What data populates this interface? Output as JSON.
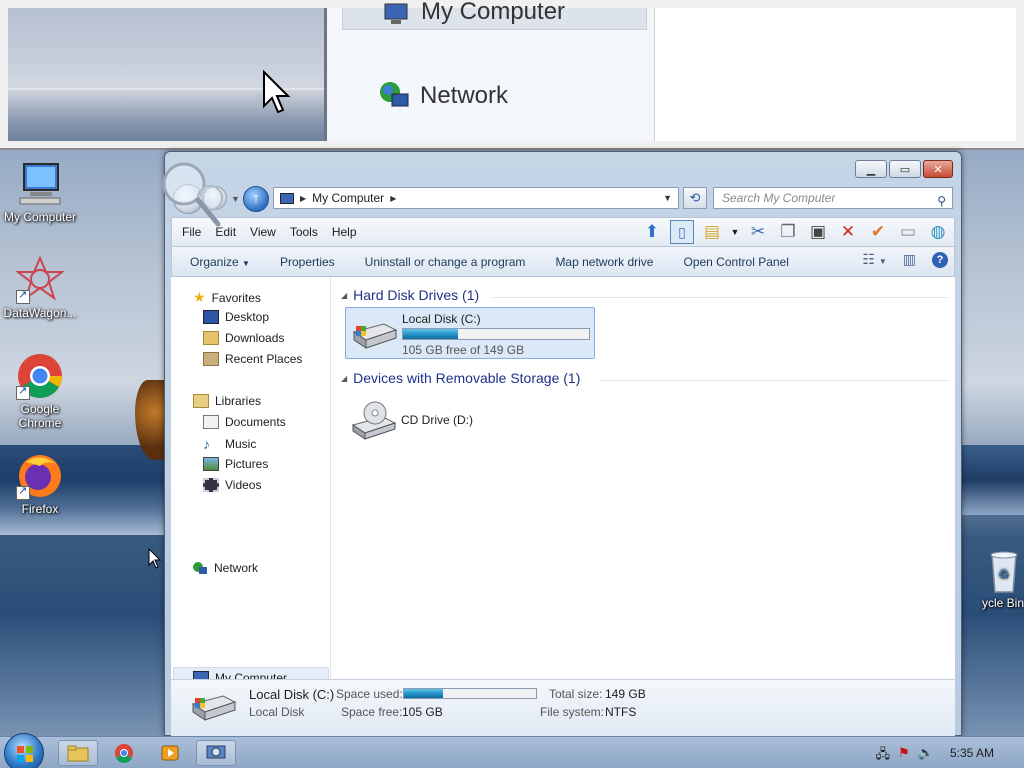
{
  "magnifier": {
    "computer_label": "My Computer",
    "network_label": "Network"
  },
  "desktop": {
    "icons": [
      {
        "label": "My Computer"
      },
      {
        "label": "DataWagon..."
      },
      {
        "label": "Google Chrome"
      },
      {
        "label": "Firefox"
      },
      {
        "label": "ycle Bin"
      }
    ]
  },
  "window": {
    "address": {
      "path": "My Computer",
      "placeholder": "Search My Computer"
    },
    "menu": [
      "File",
      "Edit",
      "View",
      "Tools",
      "Help"
    ],
    "commands": [
      "Organize",
      "Properties",
      "Uninstall or change a program",
      "Map network drive",
      "Open Control Panel"
    ],
    "nav": {
      "favorites": "Favorites",
      "favorites_items": [
        "Desktop",
        "Downloads",
        "Recent Places"
      ],
      "libraries": "Libraries",
      "libraries_items": [
        "Documents",
        "Music",
        "Pictures",
        "Videos"
      ],
      "computer": "My Computer",
      "network": "Network"
    },
    "groups": {
      "hdd_header": "Hard Disk Drives (1)",
      "removable_header": "Devices with Removable Storage (1)"
    },
    "drive_c": {
      "name": "Local Disk (C:)",
      "free_text": "105 GB free of 149 GB",
      "used_fraction": 0.2953
    },
    "drive_d": {
      "name": "CD Drive (D:)"
    },
    "details": {
      "name": "Local Disk (C:)",
      "type": "Local Disk",
      "space_used_label": "Space used:",
      "space_free_label": "Space free:",
      "space_free": "105 GB",
      "total_size_label": "Total size:",
      "total_size": "149 GB",
      "file_system_label": "File system:",
      "file_system": "NTFS",
      "used_fraction": 0.2953
    }
  },
  "taskbar": {
    "clock": "5:35 AM"
  },
  "colors": {
    "accent": "#1e3287",
    "selection": "#dbe8f7",
    "bar": "#1e8bc3"
  }
}
